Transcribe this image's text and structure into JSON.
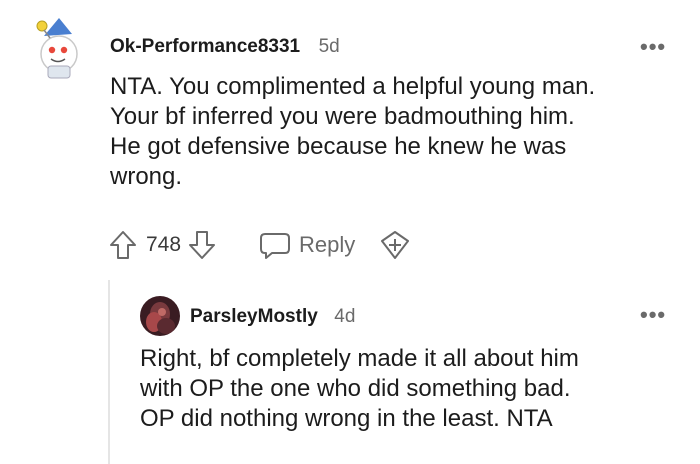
{
  "comment": {
    "username": "Ok-Performance8331",
    "age": "5d",
    "avatar_icon": "snoo-avatar-icon",
    "body_lines": [
      "NTA. You complimented a helpful young man.",
      "Your bf inferred you were badmouthing him.",
      "He got defensive because he knew he was",
      "wrong."
    ],
    "votes": "748",
    "reply_label": "Reply",
    "more_label": "•••"
  },
  "reply": {
    "username": "ParsleyMostly",
    "age": "4d",
    "avatar_icon": "user-photo-avatar",
    "body_lines": [
      "Right, bf completely made it all about him",
      "with OP the one who did something bad.",
      "OP did nothing wrong in the least. NTA"
    ],
    "more_label": "•••"
  },
  "colors": {
    "text": "#1c1c1c",
    "muted": "#6a6a6a",
    "thread_line": "#e5e5e5"
  }
}
